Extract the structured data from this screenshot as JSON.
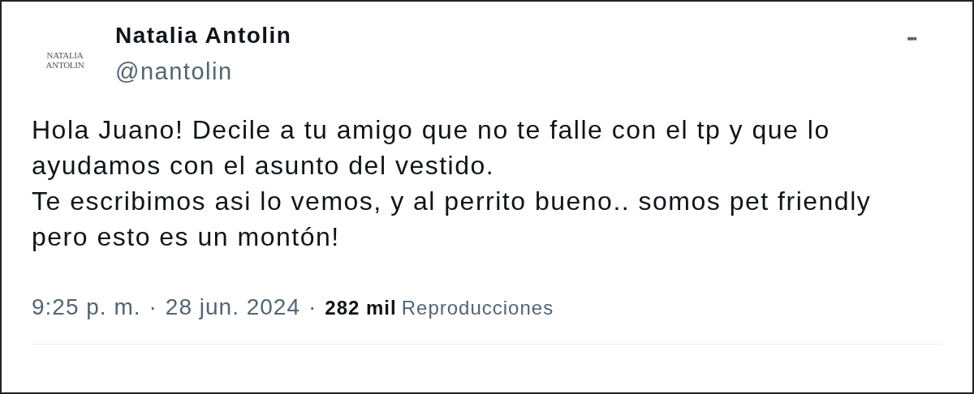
{
  "author": {
    "logo_lines": [
      "NATALIA",
      "ANTOLIN"
    ],
    "name": "Natalia Antolin",
    "handle": "@nantolin"
  },
  "more_button": "•••",
  "body": [
    "Hola Juano! Decile a tu amigo que no te falle con el tp y que lo ayudamos con el asunto del vestido.",
    "Te escribimos asi lo vemos, y al perrito bueno.. somos pet friendly pero esto es un montón!"
  ],
  "meta": {
    "time": "9:25 p. m.",
    "separator_1": "·",
    "date": "28 jun. 2024",
    "separator_2": "·",
    "views_count": "282 mil",
    "views_label": "Reproducciones"
  }
}
